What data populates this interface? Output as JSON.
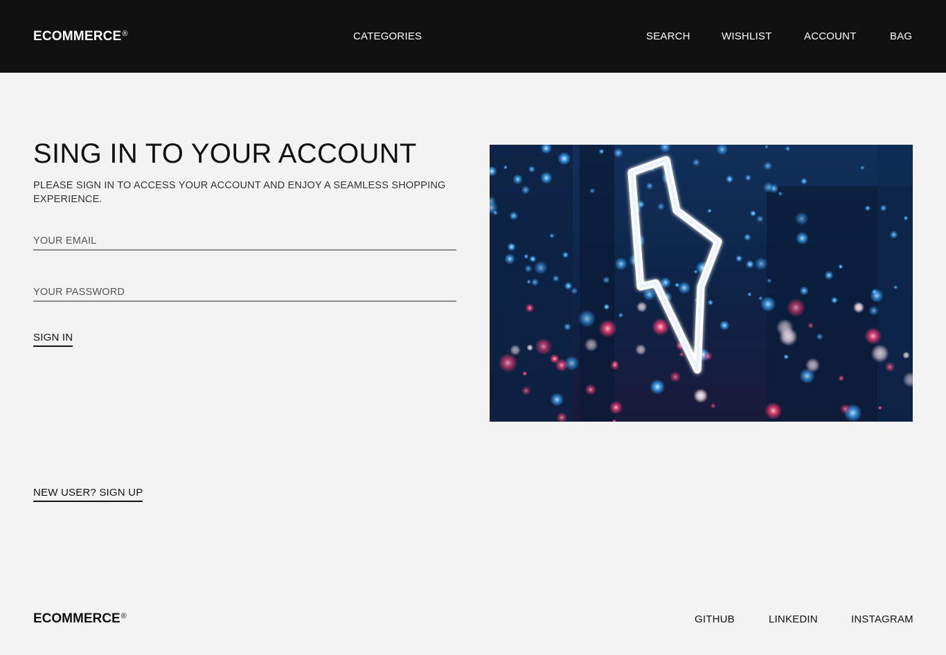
{
  "header": {
    "brand": "ECOMMERCE",
    "brand_mark": "®",
    "nav": {
      "categories": "CATEGORIES",
      "search": "SEARCH",
      "wishlist": "WISHLIST",
      "account": "ACCOUNT",
      "bag": "BAG"
    }
  },
  "signin": {
    "title": "SING IN TO YOUR ACCOUNT",
    "subtitle": "PLEASE SIGN IN TO ACCESS YOUR ACCOUNT AND ENJOY A SEAMLESS SHOPPING EXPERIENCE.",
    "email_placeholder": "YOUR EMAIL",
    "email_value": "",
    "password_placeholder": "YOUR PASSWORD",
    "password_value": "",
    "submit_label": "SIGN IN",
    "signup_label": "NEW USER? SIGN UP"
  },
  "hero": {
    "icon": "neon-lightning-bolt"
  },
  "footer": {
    "brand": "ECOMMERCE",
    "brand_mark": "®",
    "links": {
      "github": "GITHUB",
      "linkedin": "LINKEDIN",
      "instagram": "INSTAGRAM"
    }
  },
  "colors": {
    "header_bg": "#111111",
    "page_bg": "#f3f3f3",
    "text": "#111111",
    "field_underline": "#8a8a8a"
  }
}
